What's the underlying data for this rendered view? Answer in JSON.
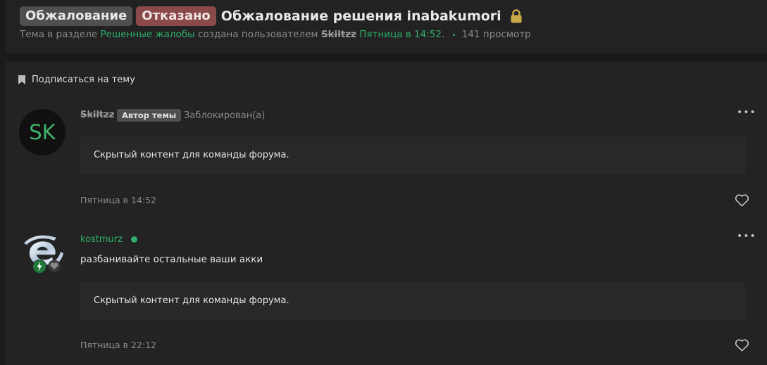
{
  "header": {
    "prefix_appeal": "Обжалование",
    "prefix_status": "Отказано",
    "title": "Обжалование решения inabakumori",
    "meta": {
      "topic_in": "Тема в разделе",
      "section": "Решенные жалобы",
      "created_by": "создана пользователем",
      "author": "Skiltzz",
      "date": "Пятница в 14:52",
      "dot": ".",
      "views": "141 просмотр"
    },
    "lock_icon": "lock-icon",
    "colors": {
      "accent": "#2fae6a",
      "status_denied": "#8a4a4a",
      "lock": "#c9a94a"
    }
  },
  "subscribe": {
    "label": "Подписаться на тему",
    "icon": "bookmark-icon"
  },
  "posts": [
    {
      "avatar_initials": "SK",
      "username": "Skiltzz",
      "badge": "Автор темы",
      "status": "Заблокирован(а)",
      "hidden_content": "Скрытый контент для команды форума.",
      "date": "Пятница в 14:52",
      "more": "•••"
    },
    {
      "username": "kostmurz",
      "online": true,
      "message": "разбанивайте остальные ваши акки",
      "hidden_content": "Скрытый контент для команды форума.",
      "date": "Пятница в 22:12",
      "more": "•••"
    }
  ]
}
